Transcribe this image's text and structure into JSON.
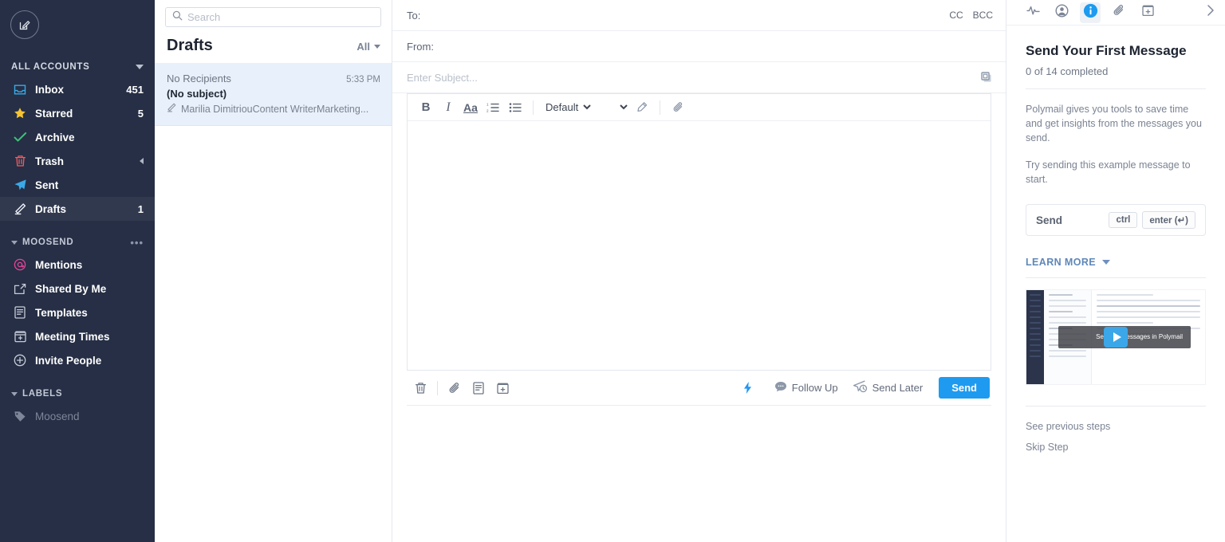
{
  "sidebar": {
    "compose_icon": "compose-icon",
    "accounts": {
      "label": "ALL ACCOUNTS",
      "caret": "chevron-down-icon"
    },
    "accounts_items": [
      {
        "icon": "inbox-icon",
        "label": "Inbox",
        "count": "451"
      },
      {
        "icon": "star-icon",
        "label": "Starred",
        "count": "5"
      },
      {
        "icon": "check-icon",
        "label": "Archive",
        "count": ""
      },
      {
        "icon": "trash-icon",
        "label": "Trash",
        "count": ""
      },
      {
        "icon": "sent-icon",
        "label": "Sent",
        "count": ""
      },
      {
        "icon": "pencil-icon",
        "label": "Drafts",
        "count": "1"
      }
    ],
    "account_section": {
      "label": "MOOSEND",
      "more": "•••"
    },
    "account_items": [
      {
        "icon": "mention-icon",
        "label": "Mentions"
      },
      {
        "icon": "share-icon",
        "label": "Shared By Me"
      },
      {
        "icon": "template-icon",
        "label": "Templates"
      },
      {
        "icon": "calendar-icon",
        "label": "Meeting Times"
      },
      {
        "icon": "plus-circle-icon",
        "label": "Invite People"
      }
    ],
    "labels_section": {
      "label": "LABELS"
    },
    "labels": [
      {
        "icon": "tag-icon",
        "label": "Moosend"
      }
    ]
  },
  "list": {
    "search": {
      "placeholder": "Search",
      "value": "",
      "icon": "search-icon"
    },
    "title": "Drafts",
    "filter": "All",
    "messages": [
      {
        "from": "No Recipients",
        "time": "5:33 PM",
        "subject": "(No subject)",
        "snippet": "Marilia DimitriouContent WriterMarketing...",
        "snippet_icon": "pencil-icon"
      }
    ]
  },
  "compose": {
    "to_label": "To:",
    "to_value": "",
    "to_placeholder": "",
    "cc_label": "CC",
    "bcc_label": "BCC",
    "from_label": "From:",
    "from_value": "",
    "subject_placeholder": "Enter Subject...",
    "subject_value": "",
    "template_icon": "copy-templates-icon",
    "format": {
      "bold": "B",
      "italic": "I",
      "underline_aa": "Aa",
      "ordered_list_icon": "ordered-list-icon",
      "bullet_list_icon": "bullet-list-icon",
      "font_selected": "Default",
      "font_options": [
        "Default"
      ],
      "size_selected": "",
      "size_options": [
        ""
      ],
      "color_icon": "text-color-icon",
      "attach_icon": "attachment-icon"
    },
    "body_value": "",
    "actions": {
      "trash_icon": "trash-icon",
      "attach_icon": "attachment-icon",
      "template_icon": "template-icon",
      "calendar_icon": "calendar-add-icon",
      "bolt_icon": "lightning-bolt-icon",
      "follow_up": "Follow Up",
      "follow_up_icon": "comment-icon",
      "send_later": "Send Later",
      "send_later_icon": "send-clock-icon",
      "send": "Send"
    }
  },
  "right_panel": {
    "tabs": [
      {
        "icon": "activity-pulse-icon",
        "active": false
      },
      {
        "icon": "contact-person-icon",
        "active": false
      },
      {
        "icon": "info-icon",
        "active": true
      },
      {
        "icon": "attachment-icon",
        "active": false
      },
      {
        "icon": "calendar-add-icon",
        "active": false
      }
    ],
    "expand_icon": "chevron-right-icon",
    "title": "Send Your First Message",
    "progress": "0 of 14 completed",
    "paragraph1": "Polymail gives you tools to save time and get insights from the messages you send.",
    "paragraph2": "Try sending this example message to start.",
    "shortcut": {
      "label": "Send",
      "key1": "ctrl",
      "key2": "enter (↵)"
    },
    "learn_more": "LEARN MORE",
    "video": {
      "title": "Sending Messages in Polymail",
      "play_icon": "play-icon"
    },
    "links": [
      "See previous steps",
      "Skip Step"
    ]
  },
  "colors": {
    "sidebar_bg": "#262f45",
    "sidebar_selected": "#31394f",
    "accent_blue": "#1e9bf0",
    "list_selected": "#e8f0fb",
    "star_yellow": "#f6c431",
    "archive_green": "#3fc07a",
    "trash_red": "#ef5d60",
    "mention_pink": "#e9449a"
  }
}
